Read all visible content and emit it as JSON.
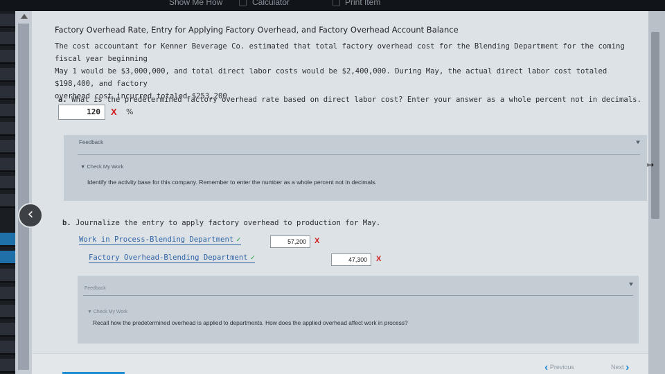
{
  "toolbar": {
    "show_me_how": "Show Me How",
    "calculator": "Calculator",
    "print_item": "Print Item"
  },
  "problem": {
    "title": "Factory Overhead Rate, Entry for Applying Factory Overhead, and Factory Overhead Account Balance",
    "intro_line1": "The cost accountant for Kenner Beverage Co. estimated that total factory overhead cost for the Blending Department for the coming fiscal year beginning",
    "intro_line2": "May 1 would be $3,000,000, and total direct labor costs would be $2,400,000. During May, the actual direct labor cost totaled $198,400, and factory",
    "intro_line3": "overhead cost incurred totaled $253,200."
  },
  "part_a": {
    "letter": "a.",
    "question": "What is the predetermined factory overhead rate based on direct labor cost? Enter your answer as a whole percent not in decimals.",
    "answer": "120",
    "mark": "X",
    "unit": "%",
    "feedback_title": "Feedback",
    "check_title": "▼ Check My Work",
    "feedback_text": "Identify the activity base for this company. Remember to enter the number as a whole percent not in decimals."
  },
  "part_b": {
    "letter": "b.",
    "question": "Journalize the entry to apply factory overhead to production for May.",
    "debit_account": "Work in Process-Blending Department",
    "debit_amount": "57,200",
    "credit_account": "Factory Overhead-Blending Department",
    "credit_amount": "47,300",
    "account_mark": "✓",
    "amount_mark": "X",
    "feedback_title": "Feedback",
    "check_title": "▼ Check My Work",
    "feedback_text": "Recall how the predetermined overhead is applied to departments. How does the applied overhead affect work in process?"
  },
  "navigation": {
    "previous": "Previous",
    "next": "Next"
  },
  "colors": {
    "error": "#d21e1e",
    "correct": "#1f9d3a",
    "link": "#2f64a6"
  }
}
